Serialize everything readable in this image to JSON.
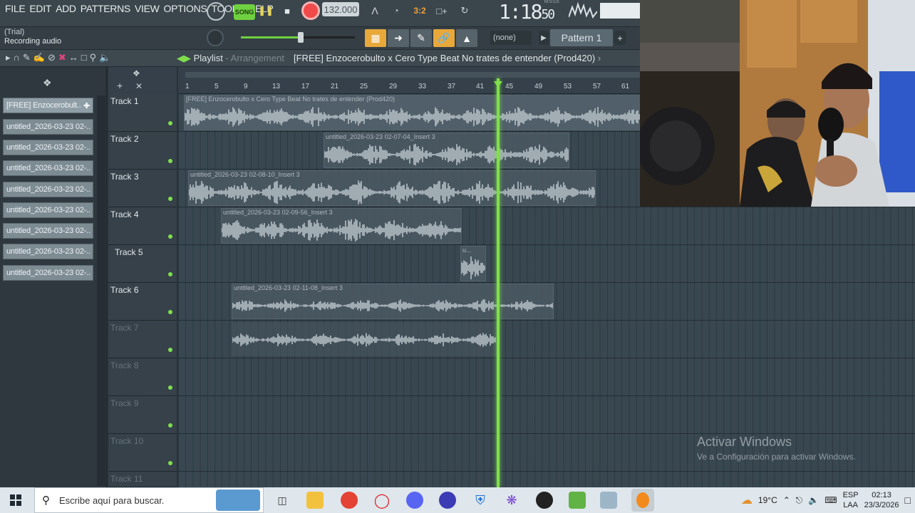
{
  "menu": [
    "FILE",
    "EDIT",
    "ADD",
    "PATTERNS",
    "VIEW",
    "OPTIONS",
    "TOOLS",
    "HELP"
  ],
  "transport": {
    "song_label": "SONG",
    "tempo": "132.000",
    "time_main": "1:18",
    "time_sub": "50",
    "time_unit": "M:S:CS"
  },
  "hint": {
    "line1": "(Trial)",
    "line2": "Recording audio"
  },
  "pattern": {
    "none_label": "(none)",
    "pattern_label": "Pattern 1"
  },
  "playlist": {
    "title": "Playlist",
    "sep": " - ",
    "view": "Arrangement",
    "project_name": "[FREE] Enzocerobulto x Cero  Type Beat  No trates de entender  (Prod420)"
  },
  "channels": [
    "[FREE] Enzocerobult..",
    "untitled_2026-03-23 02-..",
    "untitled_2026-03-23 02-..",
    "untitled_2026-03-23 02-..",
    "untitled_2026-03-23 02-..",
    "untitled_2026-03-23 02-..",
    "untitled_2026-03-23 02-..",
    "untitled_2026-03-23 02-..",
    "untitled_2026-03-23 02-.."
  ],
  "tracks": [
    "Track 1",
    "Track 2",
    "Track 3",
    "Track 4",
    "Track 5",
    "Track 6",
    "Track 7",
    "Track 8",
    "Track 9",
    "Track 10",
    "Track 11"
  ],
  "ruler_ticks": [
    "1",
    "5",
    "9",
    "13",
    "17",
    "21",
    "25",
    "29",
    "33",
    "37",
    "41",
    "45",
    "49",
    "53",
    "57",
    "61"
  ],
  "clips": [
    {
      "label": "[FREE] Enzocerobulto x Cero  Type Beat  No trates de entender  (Prod420)"
    },
    {
      "label": "untitled_2026-03-23 02-07-04_Insert 3"
    },
    {
      "label": "untitled_2026-03-23 02-08-10_Insert 3"
    },
    {
      "label": "untitled_2026-03-23 02-09-56_Insert 3"
    },
    {
      "label": "u..."
    },
    {
      "label": "untitled_2026-03-23 02-11-08_Insert 3"
    },
    {
      "label": ""
    }
  ],
  "watermark": {
    "title": "Activar Windows",
    "sub": "Ve a Configuración para activar Windows."
  },
  "taskbar": {
    "search_placeholder": "Escribe aquí para buscar.",
    "temp": "19°C",
    "lang1": "ESP",
    "lang2": "LAA",
    "time": "02:13",
    "date": "23/3/2026"
  }
}
